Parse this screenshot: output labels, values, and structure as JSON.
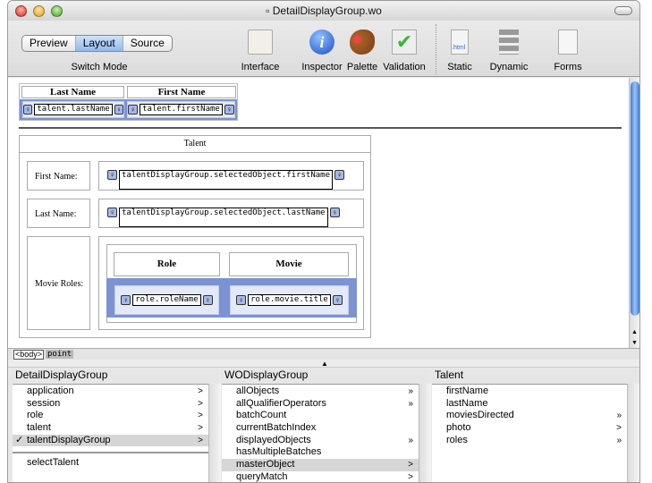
{
  "window": {
    "title": "DetailDisplayGroup.wo"
  },
  "toolbar": {
    "modes": [
      "Preview",
      "Layout",
      "Source"
    ],
    "active_mode": "Layout",
    "switch_label": "Switch Mode",
    "items": [
      {
        "label": "Interface",
        "icon": "interface-icon"
      },
      {
        "label": "Inspector",
        "icon": "info-icon"
      },
      {
        "label": "Palette",
        "icon": "palette-icon"
      },
      {
        "label": "Validation",
        "icon": "validation-icon"
      },
      {
        "label": "Static",
        "icon": "html-doc-icon"
      },
      {
        "label": "Dynamic",
        "icon": "dynamic-elements-icon"
      },
      {
        "label": "Forms",
        "icon": "forms-icon"
      }
    ]
  },
  "layout": {
    "top_table": {
      "headers": [
        "Last Name",
        "First Name"
      ],
      "bindings": [
        "talent.lastName",
        "talent.firstName"
      ]
    },
    "talent_table": {
      "title": "Talent",
      "rows": [
        {
          "label": "First Name:",
          "binding": "talentDisplayGroup.selectedObject.firstName"
        },
        {
          "label": "Last Name:",
          "binding": "talentDisplayGroup.selectedObject.lastName"
        }
      ],
      "movie_roles": {
        "label": "Movie Roles:",
        "headers": [
          "Role",
          "Movie"
        ],
        "bindings": [
          "role.roleName",
          "role.movie.title"
        ]
      }
    }
  },
  "status": {
    "path": [
      "<body>",
      "point"
    ]
  },
  "browser": {
    "columns": [
      {
        "title": "DetailDisplayGroup",
        "items": [
          {
            "name": "application",
            "arrow": ">"
          },
          {
            "name": "session",
            "arrow": ">"
          },
          {
            "name": "role",
            "arrow": ">"
          },
          {
            "name": "talent",
            "arrow": ">"
          },
          {
            "name": "talentDisplayGroup",
            "arrow": ">",
            "selected": true,
            "checked": "✓"
          }
        ],
        "actions": [
          "selectTalent"
        ]
      },
      {
        "title": "WODisplayGroup",
        "items": [
          {
            "name": "allObjects",
            "arrow": "»"
          },
          {
            "name": "allQualifierOperators",
            "arrow": "»"
          },
          {
            "name": "batchCount",
            "arrow": ""
          },
          {
            "name": "currentBatchIndex",
            "arrow": ""
          },
          {
            "name": "displayedObjects",
            "arrow": "»"
          },
          {
            "name": "hasMultipleBatches",
            "arrow": ""
          },
          {
            "name": "masterObject",
            "arrow": ">",
            "selected": true
          },
          {
            "name": "queryMatch",
            "arrow": ">"
          }
        ]
      },
      {
        "title": "Talent",
        "items": [
          {
            "name": "firstName",
            "arrow": ""
          },
          {
            "name": "lastName",
            "arrow": ""
          },
          {
            "name": "moviesDirected",
            "arrow": "»"
          },
          {
            "name": "photo",
            "arrow": ">"
          },
          {
            "name": "roles",
            "arrow": "»"
          }
        ]
      }
    ]
  }
}
